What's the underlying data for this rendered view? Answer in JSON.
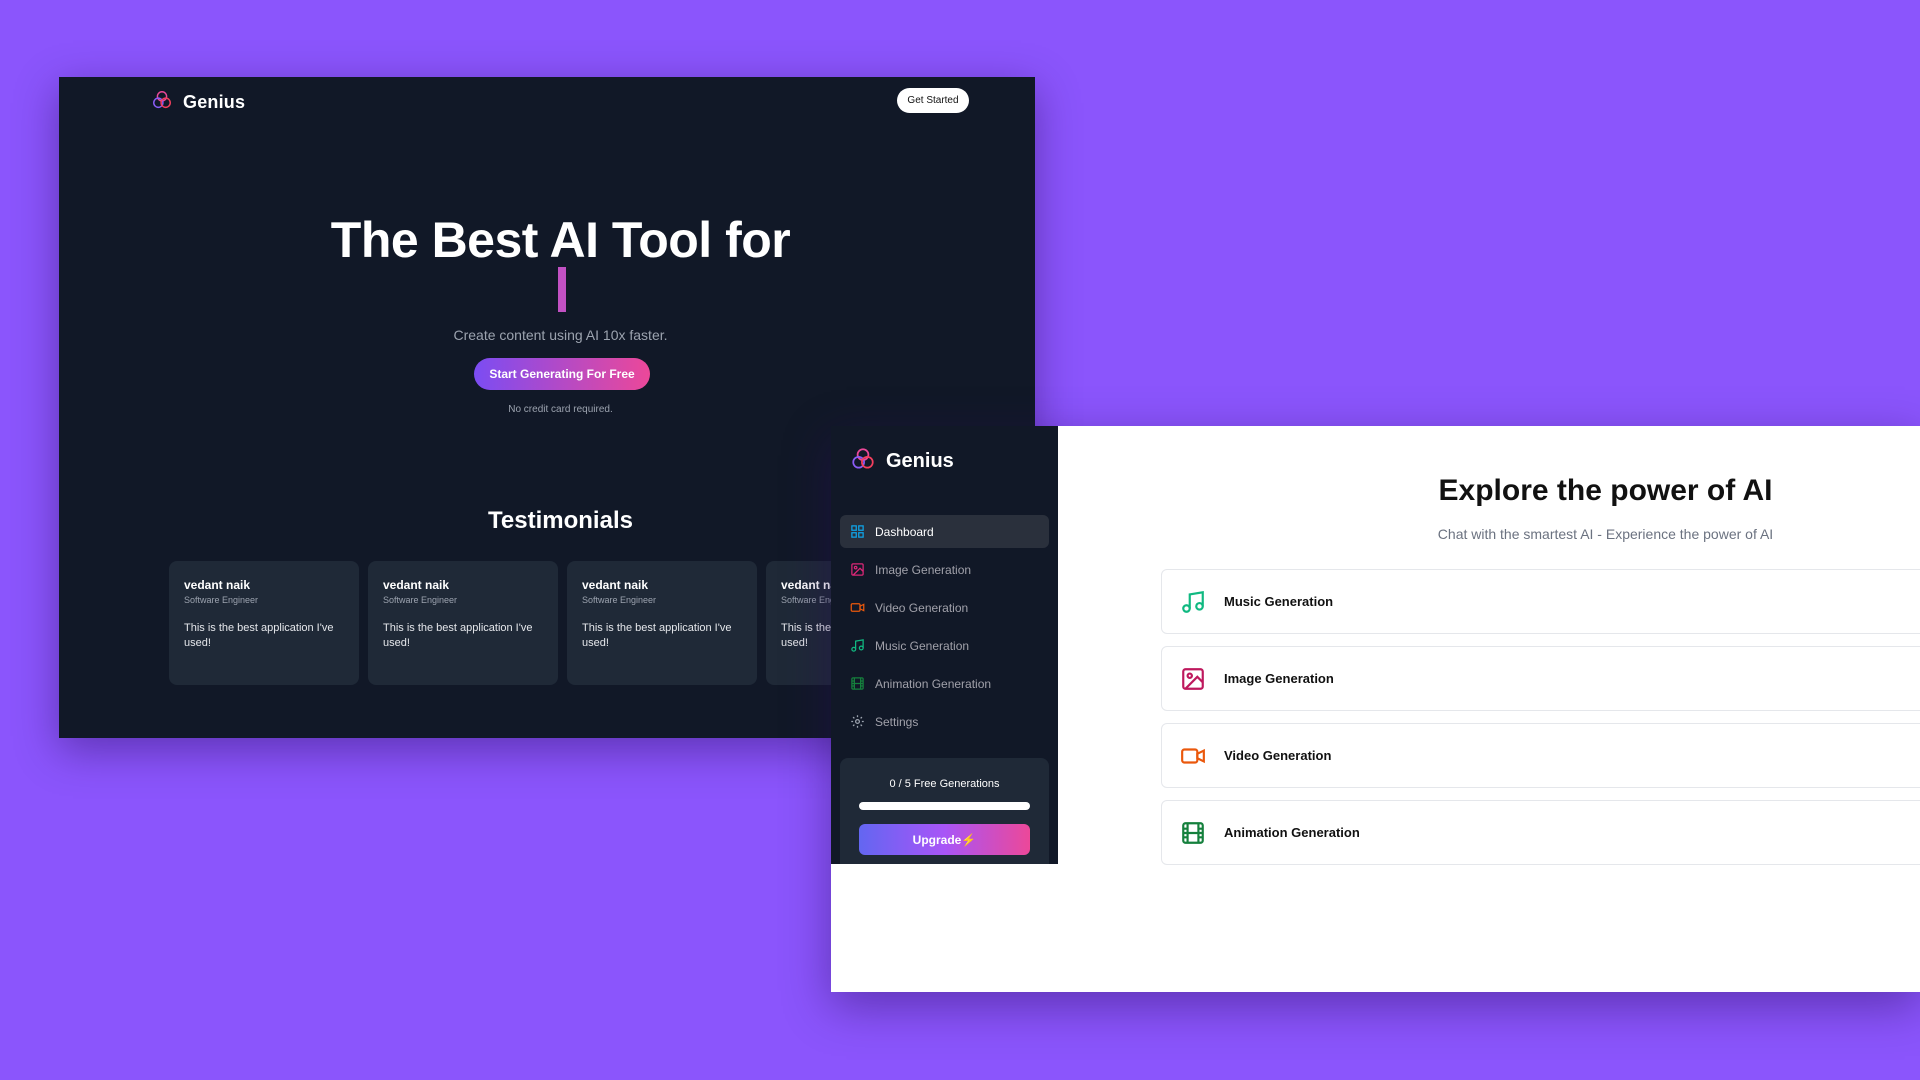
{
  "landing": {
    "brand": "Genius",
    "nav_button": "Get Started",
    "hero": {
      "title": "The Best AI Tool for",
      "subtitle": "Create content using AI 10x faster.",
      "cta": "Start Generating For Free",
      "note": "No credit card required."
    },
    "testimonials_heading": "Testimonials",
    "testimonials": [
      {
        "name": "vedant naik",
        "role": "Software Engineer",
        "quote": "This is the best application I've used!"
      },
      {
        "name": "vedant naik",
        "role": "Software Engineer",
        "quote": "This is the best application I've used!"
      },
      {
        "name": "vedant naik",
        "role": "Software Engineer",
        "quote": "This is the best application I've used!"
      },
      {
        "name": "vedant naik",
        "role": "Software Engineer",
        "quote": "This is the best application I've used!"
      }
    ]
  },
  "dashboard": {
    "brand": "Genius",
    "sidebar": [
      {
        "label": "Dashboard",
        "icon": "layout-dashboard-icon",
        "color": "#0ea5e9"
      },
      {
        "label": "Image Generation",
        "icon": "image-icon",
        "color": "#db2777"
      },
      {
        "label": "Video Generation",
        "icon": "video-icon",
        "color": "#ea580c"
      },
      {
        "label": "Music Generation",
        "icon": "music-icon",
        "color": "#10b981"
      },
      {
        "label": "Animation Generation",
        "icon": "film-icon",
        "color": "#15803d"
      },
      {
        "label": "Settings",
        "icon": "gear-icon",
        "color": "#9ca3af"
      }
    ],
    "usage": {
      "text": "0 / 5 Free Generations",
      "used": 0,
      "limit": 5
    },
    "upgrade_label": "Upgrade",
    "title": "Explore the power of AI",
    "subtitle": "Chat with the smartest AI - Experience the power of AI",
    "tools": [
      {
        "label": "Music Generation",
        "icon": "music-icon",
        "color": "#10b981"
      },
      {
        "label": "Image Generation",
        "icon": "image-icon",
        "color": "#be185d"
      },
      {
        "label": "Video Generation",
        "icon": "video-icon",
        "color": "#ea580c"
      },
      {
        "label": "Animation Generation",
        "icon": "film-icon",
        "color": "#15803d"
      }
    ]
  },
  "colors": {
    "background": "#8b55fc",
    "landing_bg": "#111827",
    "card_bg": "#1f2937",
    "accent_start": "#7b4cf3",
    "accent_end": "#ec4899"
  }
}
